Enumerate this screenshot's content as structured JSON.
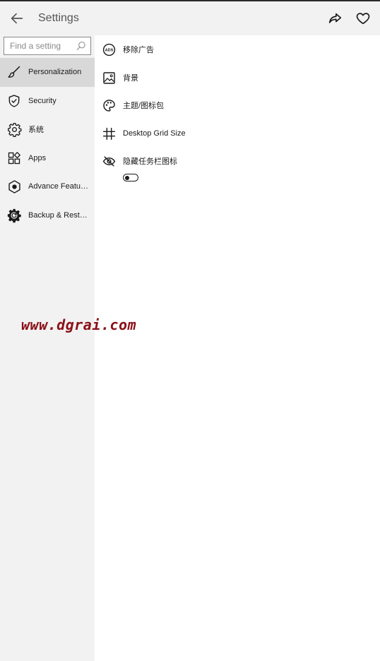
{
  "header": {
    "title": "Settings",
    "back_icon": "arrow-left-icon",
    "share_icon": "share-icon",
    "favorite_icon": "heart-icon"
  },
  "sidebar": {
    "search": {
      "placeholder": "Find a setting",
      "value": "",
      "icon": "search-icon"
    },
    "items": [
      {
        "label": "Personalization",
        "icon": "brush-icon",
        "active": true
      },
      {
        "label": "Security",
        "icon": "shield-icon",
        "active": false
      },
      {
        "label": "系统",
        "icon": "gear-icon",
        "active": false
      },
      {
        "label": "Apps",
        "icon": "apps-icon",
        "active": false
      },
      {
        "label": "Advance Featur...",
        "icon": "hexagon-icon",
        "active": false
      },
      {
        "label": "Backup & Restore",
        "icon": "backup-gear-icon",
        "active": false
      }
    ]
  },
  "content": {
    "items": [
      {
        "label": "移除广告",
        "icon": "ads-icon"
      },
      {
        "label": "背景",
        "icon": "image-icon"
      },
      {
        "label": "主题/图标包",
        "icon": "palette-icon"
      },
      {
        "label": "Desktop Grid Size",
        "icon": "grid-icon"
      },
      {
        "label": "隐藏任务栏图标",
        "icon": "eye-off-icon"
      }
    ],
    "hide_taskbar_toggle": {
      "on": false
    }
  },
  "watermark": "www.dgrai.com",
  "colors": {
    "sidebar_bg": "#f2f2f2",
    "active_item_bg": "#d8d8d8",
    "content_bg": "#ffffff",
    "watermark": "#8b0f16"
  }
}
